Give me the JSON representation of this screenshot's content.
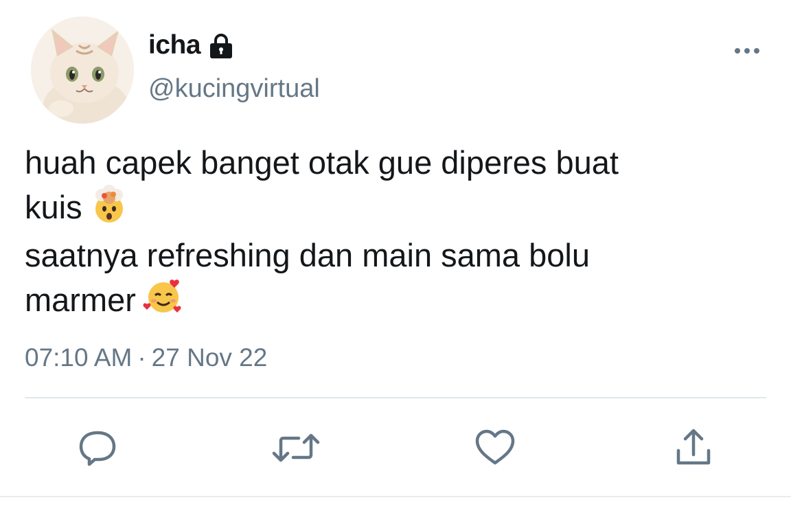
{
  "user": {
    "display_name": "icha",
    "handle": "@kucingvirtual",
    "protected_icon": "lock-icon",
    "avatar_icon": "cat-avatar"
  },
  "tweet": {
    "lines": [
      "huah capek banget otak gue diperes buat",
      "kuis",
      "saatnya refreshing dan main sama bolu",
      "marmer"
    ],
    "emojis": [
      "exploding-head-emoji",
      "smiling-face-with-hearts-emoji"
    ],
    "time": "07:10 AM",
    "separator": "·",
    "date": "27 Nov 22"
  },
  "actions": [
    {
      "icon": "reply-icon"
    },
    {
      "icon": "retweet-icon"
    },
    {
      "icon": "like-icon"
    },
    {
      "icon": "share-icon"
    }
  ],
  "colors": {
    "text": "#14171a",
    "secondary": "#657786",
    "divider": "#e1e8ed"
  }
}
